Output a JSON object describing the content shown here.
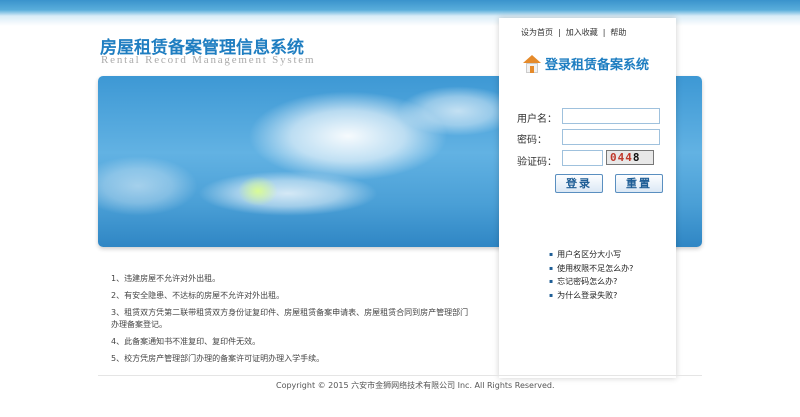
{
  "header": {
    "title": "房屋租赁备案管理信息系统",
    "subtitle": "Rental Record Management System"
  },
  "toplinks": [
    "设为首页",
    "加入收藏",
    "帮助"
  ],
  "login": {
    "title": "登录租赁备案系统",
    "icon": "house-icon",
    "username_label": "用户名：",
    "username_value": "",
    "password_label": "密码：",
    "password_value": "",
    "captcha_label": "验证码：",
    "captcha_value": "",
    "captcha_text": [
      "0",
      "4",
      "4",
      "8"
    ],
    "captcha_colors": [
      "#c0392b",
      "#c0392b",
      "#c0392b",
      "#111111"
    ],
    "login_button": "登录",
    "reset_button": "重置"
  },
  "tips": [
    "用户名区分大小写",
    "使用权限不足怎么办?",
    "忘记密码怎么办?",
    "为什么登录失败?"
  ],
  "notes": [
    "1、违建房屋不允许对外出租。",
    "2、有安全隐患、不达标的房屋不允许对外出租。",
    "3、租赁双方凭第二联带租赁双方身份证复印件、房屋租赁备案申请表、房屋租赁合同到房产管理部门办理备案登记。",
    "4、此备案通知书不准复印、复印件无效。",
    "5、校方凭房产管理部门办理的备案许可证明办理入学手续。"
  ],
  "footer": {
    "copyright": "Copyright © 2015 六安市金狮网络技术有限公司 Inc. All Rights Reserved."
  }
}
